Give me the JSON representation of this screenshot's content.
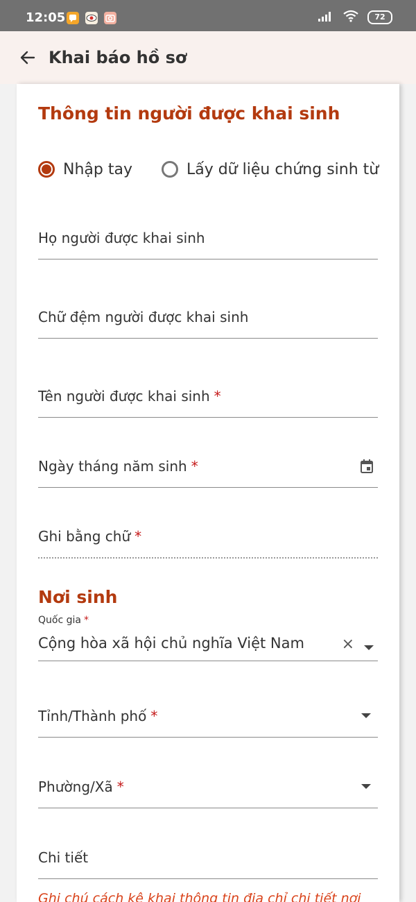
{
  "status_bar": {
    "time": "12:05",
    "battery": "72",
    "icons": [
      "chat-app-icon",
      "eye-app-icon",
      "camera-app-icon",
      "signal-icon",
      "wifi-icon"
    ]
  },
  "app_bar": {
    "title": "Khai báo hồ sơ"
  },
  "section1": {
    "title": "Thông tin người được khai sinh",
    "radio_options": [
      {
        "label": "Nhập tay",
        "selected": true
      },
      {
        "label": "Lấy dữ liệu chứng sinh từ",
        "selected": false
      }
    ],
    "fields": {
      "surname": {
        "label": "Họ người được khai sinh"
      },
      "middle_name": {
        "label": "Chữ đệm người được khai sinh"
      },
      "given_name": {
        "label": "Tên người được khai sinh",
        "required": "*"
      },
      "dob": {
        "label": "Ngày tháng năm sinh",
        "required": "*"
      },
      "dob_words": {
        "label": "Ghi bằng chữ",
        "required": "*"
      }
    }
  },
  "section2": {
    "title": "Nơi sinh",
    "country": {
      "label": "Quốc gia",
      "required": "*",
      "value": "Cộng hòa xã hội chủ nghĩa Việt Nam"
    },
    "province": {
      "label": "Tỉnh/Thành phố",
      "required": "*"
    },
    "ward": {
      "label": "Phường/Xã",
      "required": "*"
    },
    "detail": {
      "label": "Chi tiết"
    },
    "note": "Ghi chú cách kê khai thông tin địa chỉ chi tiết nơi"
  },
  "colors": {
    "accent": "#b33a0f",
    "required": "#c51a1a",
    "note": "#d9421a"
  }
}
